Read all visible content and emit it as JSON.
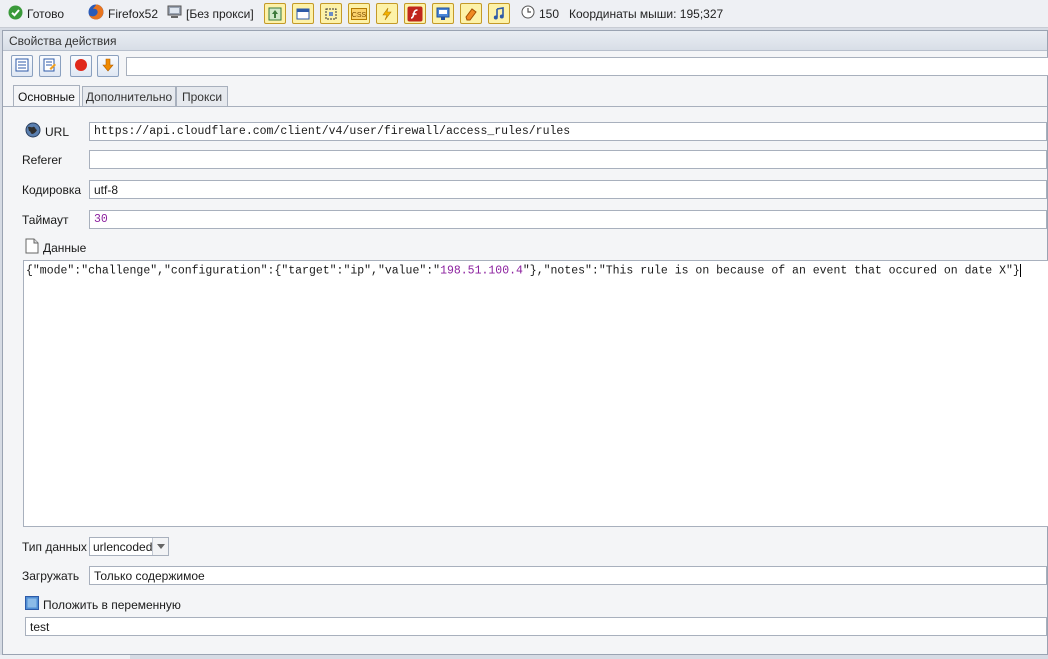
{
  "statusbar": {
    "ready_label": "Готово",
    "browser_label": "Firefox52",
    "proxy_label": "[Без прокси]",
    "threads_count": "150",
    "mouse_coords": "Координаты мыши: 195;327",
    "colors": {
      "ready": "#3a9a3a",
      "toolbar_btn_bg": "#fdf2a8"
    }
  },
  "panel": {
    "title": "Свойства действия",
    "action_name_value": "",
    "tabs": [
      {
        "label": "Основные",
        "active": true
      },
      {
        "label": "Дополнительно",
        "active": false
      },
      {
        "label": "Прокси",
        "active": false
      }
    ]
  },
  "form": {
    "url_label": "URL",
    "url_value": "https://api.cloudflare.com/client/v4/user/firewall/access_rules/rules",
    "referer_label": "Referer",
    "referer_value": "",
    "encoding_label": "Кодировка",
    "encoding_value": "utf-8",
    "timeout_label": "Таймаут",
    "timeout_value": "30",
    "data_label": "Данные",
    "data_parts": {
      "p1": "{\"mode\":\"challenge\",\"configuration\":{\"target\":\"ip\",\"value\":\"",
      "ip": "198.51.100.4",
      "p2": "\"},\"notes\":\"This rule is on because of an event that occured on date X\"}"
    },
    "data_type_label": "Тип данных",
    "data_type_value": "urlencoded",
    "load_label": "Загружать",
    "load_value": "Только содержимое",
    "save_to_var_label": "Положить в переменную",
    "variable_value": "test"
  }
}
